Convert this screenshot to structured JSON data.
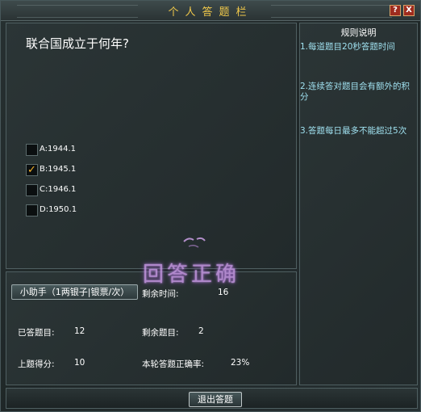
{
  "window": {
    "title": "个人答题栏"
  },
  "titlebar": {
    "help_label": "?",
    "close_label": "X"
  },
  "question": {
    "text": "联合国成立于何年?",
    "options": [
      {
        "label": "A:1944.1",
        "checked": false,
        "mark": ""
      },
      {
        "label": "B:1945.1",
        "checked": true,
        "mark": "✓"
      },
      {
        "label": "C:1946.1",
        "checked": false,
        "mark": ""
      },
      {
        "label": "D:1950.1",
        "checked": false,
        "mark": ""
      }
    ]
  },
  "rules": {
    "title": "规则说明",
    "items": [
      "1.每道题目20秒答题时间",
      "2.连续答对题目会有额外的积分",
      "3.答题每日最多不能超过5次"
    ]
  },
  "feedback": {
    "text": "回答正确",
    "color": "#c898e6"
  },
  "info": {
    "helper_button": "小助手（1两银子|银票/次）",
    "time_left_label": "剩余时间:",
    "time_left_value": "16",
    "answered_label": "已答题目:",
    "answered_value": "12",
    "remaining_label": "剩余题目:",
    "remaining_value": "2",
    "last_score_label": "上题得分:",
    "last_score_value": "10",
    "accuracy_label": "本轮答题正确率:",
    "accuracy_value": "23%"
  },
  "footer": {
    "exit_button": "退出答题"
  },
  "colors": {
    "title_text": "#f0c84a",
    "rules_text": "#9fe0ef",
    "check_mark": "#f4b22a"
  }
}
